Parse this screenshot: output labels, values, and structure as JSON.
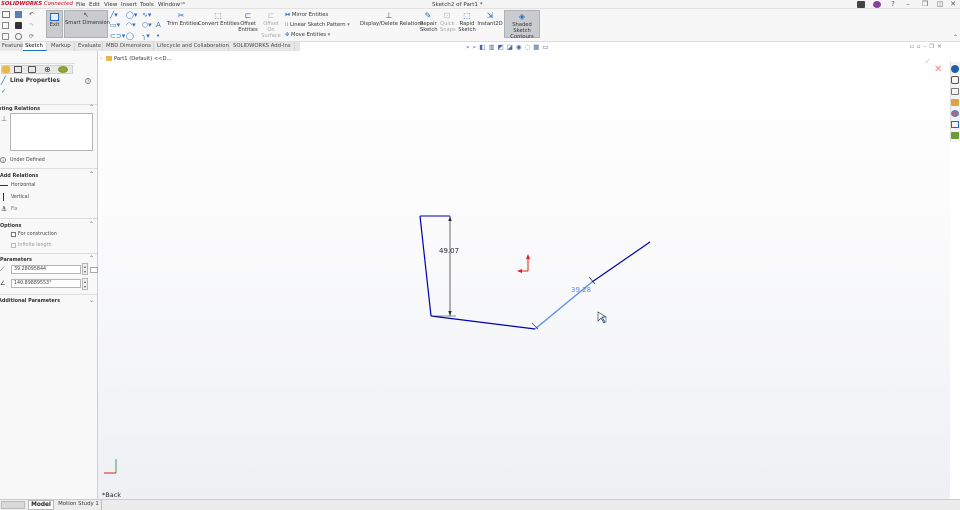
{
  "app": {
    "brand_name": "SOLIDWORKS",
    "brand_suffix": "Connected",
    "doc_title": "Sketch2 of Part1 *"
  },
  "menu": [
    "File",
    "Edit",
    "View",
    "Insert",
    "Tools",
    "Window"
  ],
  "ribbon": {
    "exit": "Exit",
    "smart_dimension": "Smart Dimension",
    "trim": "Trim Entities",
    "convert": "Convert Entities",
    "offset": "Offset Entities",
    "offset_surface": "Offset On Surface",
    "mirror": "Mirror Entities",
    "linear_pattern": "Linear Sketch Pattern",
    "move": "Move Entities",
    "display_delete": "Display/Delete Relations",
    "repair": "Repair Sketch",
    "quick": "Quick Snaps",
    "rapid": "Rapid Sketch",
    "instant2d": "Instant2D",
    "shaded": "Shaded Sketch Contours"
  },
  "tabs": [
    "Features",
    "Sketch",
    "Markup",
    "Evaluate",
    "MBD Dimensions",
    "Lifecycle and Collaboration",
    "SOLIDWORKS Add-Ins"
  ],
  "active_tab": "Sketch",
  "tree": {
    "item": "Part1 (Default) <<D..."
  },
  "panel": {
    "title": "Line Properties",
    "existing_relations": "Existing Relations",
    "under_defined": "Under Defined",
    "add_relations": "Add Relations",
    "rel_horizontal": "Horizontal",
    "rel_vertical": "Vertical",
    "rel_fix": "Fix",
    "options": "Options",
    "opt_construction": "For construction",
    "opt_infinite": "Infinite length",
    "parameters": "Parameters",
    "length_value": "39.28095844",
    "angle_value": "140.89889553°",
    "additional": "Additional Parameters"
  },
  "sketch": {
    "dim_vertical": "49.07",
    "dim_line": "39.28"
  },
  "view": {
    "orientation": "*Back"
  },
  "bottom_tabs": [
    "Model",
    "Motion Study 1"
  ],
  "colors": {
    "sketch_line": "#0000b4",
    "selected_line": "#5a8ee8",
    "dimension": "#2a2a2a",
    "accent": "#1e73be",
    "brand": "#c8102e"
  }
}
